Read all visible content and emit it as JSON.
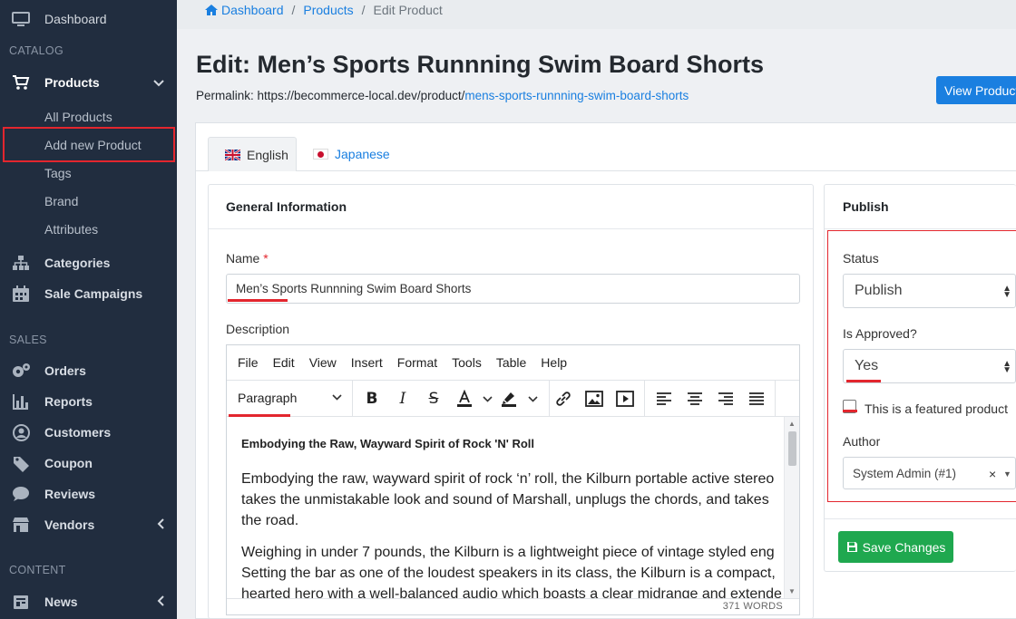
{
  "sidebar": {
    "dashboard": "Dashboard",
    "catalog_heading": "CATALOG",
    "products": "Products",
    "sub_items": [
      "All Products",
      "Add new Product",
      "Tags",
      "Brand",
      "Attributes"
    ],
    "categories": "Categories",
    "sale_campaigns": "Sale Campaigns",
    "sales_heading": "SALES",
    "sales_items": [
      "Orders",
      "Reports",
      "Customers",
      "Coupon",
      "Reviews",
      "Vendors"
    ],
    "content_heading": "CONTENT",
    "news": "News"
  },
  "breadcrumb": {
    "home": "Dashboard",
    "products": "Products",
    "current": "Edit Product"
  },
  "page": {
    "title": "Edit: Men’s Sports Runnning Swim Board Shorts",
    "permalink_label": "Permalink: https://becommerce-local.dev/product/",
    "permalink_slug": "mens-sports-runnning-swim-board-shorts",
    "view_button": "View Product"
  },
  "tabs": [
    {
      "label": "English",
      "active": true
    },
    {
      "label": "Japanese",
      "active": false
    }
  ],
  "general": {
    "title": "General Information",
    "name_label": "Name",
    "name_required": "*",
    "name_value": "Men’s Sports Runnning Swim Board Shorts",
    "description_label": "Description"
  },
  "editor": {
    "menu": [
      "File",
      "Edit",
      "View",
      "Insert",
      "Format",
      "Tools",
      "Table",
      "Help"
    ],
    "block_format": "Paragraph",
    "heading": "Embodying the Raw, Wayward Spirit of Rock 'N' Roll",
    "paragraph1_lines": [
      "Embodying the raw, wayward spirit of rock ‘n’ roll, the Kilburn portable active stereo",
      "takes the unmistakable look and sound of Marshall, unplugs the chords, and takes",
      "the road."
    ],
    "paragraph2_lines": [
      "Weighing in under 7 pounds, the Kilburn is a lightweight piece of vintage styled eng",
      "Setting the bar as one of the loudest speakers in its class, the Kilburn is a compact,",
      "hearted hero with a well-balanced audio which boasts a clear midrange and extende"
    ],
    "word_count": "371 WORDS"
  },
  "publish": {
    "title": "Publish",
    "status_label": "Status",
    "status_value": "Publish",
    "approved_label": "Is Approved?",
    "approved_value": "Yes",
    "featured_label": "This is a featured product",
    "author_label": "Author",
    "author_value": "System Admin (#1)",
    "author_clear": "×",
    "save_button": "Save Changes"
  },
  "colors": {
    "sidebar_bg": "#212d3f",
    "accent_blue": "#1a7fe0",
    "save_green": "#1fa84f",
    "highlight_red": "#e3262e"
  }
}
